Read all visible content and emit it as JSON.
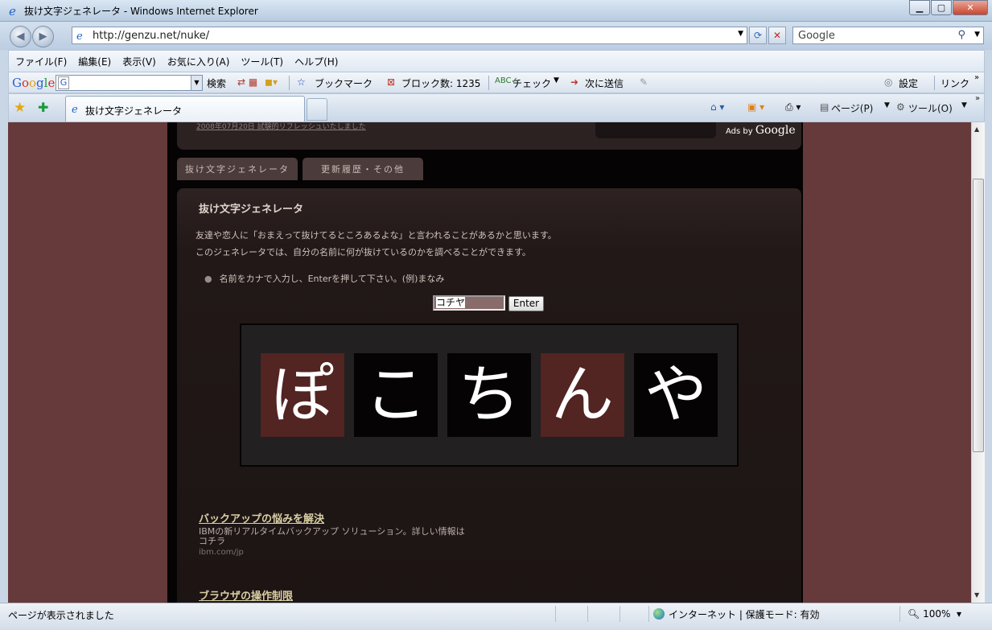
{
  "window": {
    "title": "抜け文字ジェネレータ - Windows Internet Explorer",
    "minimize_icon": "minimize-icon",
    "maximize_icon": "maximize-icon",
    "close_icon": "close-icon"
  },
  "address_bar": {
    "url": "http://genzu.net/nuke/",
    "search_placeholder": "Google"
  },
  "menu": {
    "items": [
      "ファイル(F)",
      "編集(E)",
      "表示(V)",
      "お気に入り(A)",
      "ツール(T)",
      "ヘルプ(H)"
    ]
  },
  "google_toolbar": {
    "logo": "Google",
    "search_label": "検索",
    "bookmarks": "ブックマーク",
    "blocked": "ブロック数: 1235",
    "check": "チェック",
    "send": "次に送信",
    "settings": "設定",
    "links": "リンク"
  },
  "tabs": {
    "active_label": "抜け文字ジェネレータ"
  },
  "command_bar": {
    "page": "ページ(P)",
    "tools": "ツール(O)"
  },
  "page": {
    "old_link": "2008年07月20日 試験的リフレッシュいたしました",
    "ads_by": "Ads by",
    "ads_brand": "Google",
    "nav_tabs": [
      "抜け文字ジェネレータ",
      "更新履歴・その他"
    ],
    "heading": "抜け文字ジェネレータ",
    "desc1": "友達や恋人に「おまえって抜けてるところあるよな」と言われることがあるかと思います。",
    "desc2": "このジェネレータでは、自分の名前に何が抜けているのかを調べることができます。",
    "instruction": "名前をカナで入力し、Enterを押して下さい。(例)まなみ",
    "input_value": "コチヤ",
    "enter_label": "Enter",
    "result_chars": [
      {
        "char": "ぽ",
        "highlighted": true
      },
      {
        "char": "こ",
        "highlighted": false
      },
      {
        "char": "ち",
        "highlighted": false
      },
      {
        "char": "ん",
        "highlighted": true
      },
      {
        "char": "や",
        "highlighted": false
      }
    ],
    "ads": [
      {
        "title": "バックアップの悩みを解決",
        "text": "IBMの新リアルタイムバックアップ ソリューション。詳しい情報はコチラ",
        "url": "ibm.com/jp"
      },
      {
        "title": "ブラウザの操作制限",
        "text": "",
        "url": ""
      }
    ],
    "colors": {
      "background": "#66393a",
      "highlight_tile": "#522422",
      "plain_tile": "#050303"
    }
  },
  "status_bar": {
    "message": "ページが表示されました",
    "zone": "インターネット | 保護モード: 有効",
    "zoom": "100%"
  }
}
